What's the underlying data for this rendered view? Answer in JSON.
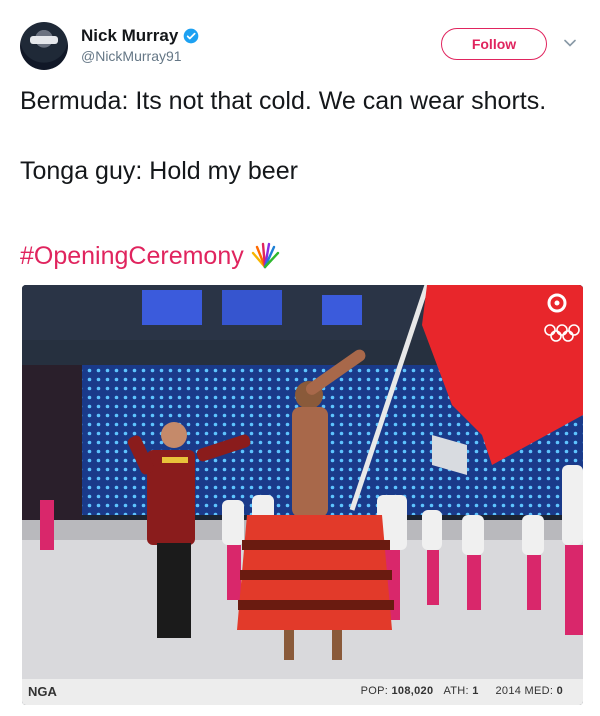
{
  "header": {
    "display_name": "Nick Murray",
    "handle": "@NickMurray91",
    "follow_label": "Follow",
    "verified": true
  },
  "tweet": {
    "line1": "Bermuda: Its not that cold. We can wear shorts.",
    "line2": "Tonga guy: Hold my beer",
    "hashtag": "#OpeningCeremony"
  },
  "media": {
    "country_code": "NGA",
    "pop_label": "POP:",
    "pop_value": "108,020",
    "ath_label": "ATH:",
    "ath_value": "1",
    "med_label": "2014 MED:",
    "med_value": "0"
  },
  "colors": {
    "accent": "#e0245e",
    "verified": "#1da1f2",
    "flag_red": "#e8262b",
    "skirt_red": "#e23a2a"
  },
  "icons": [
    "verified-badge-icon",
    "chevron-down-icon",
    "nbc-sparkle-icon",
    "cbc-logo-icon",
    "olympic-rings-icon"
  ]
}
